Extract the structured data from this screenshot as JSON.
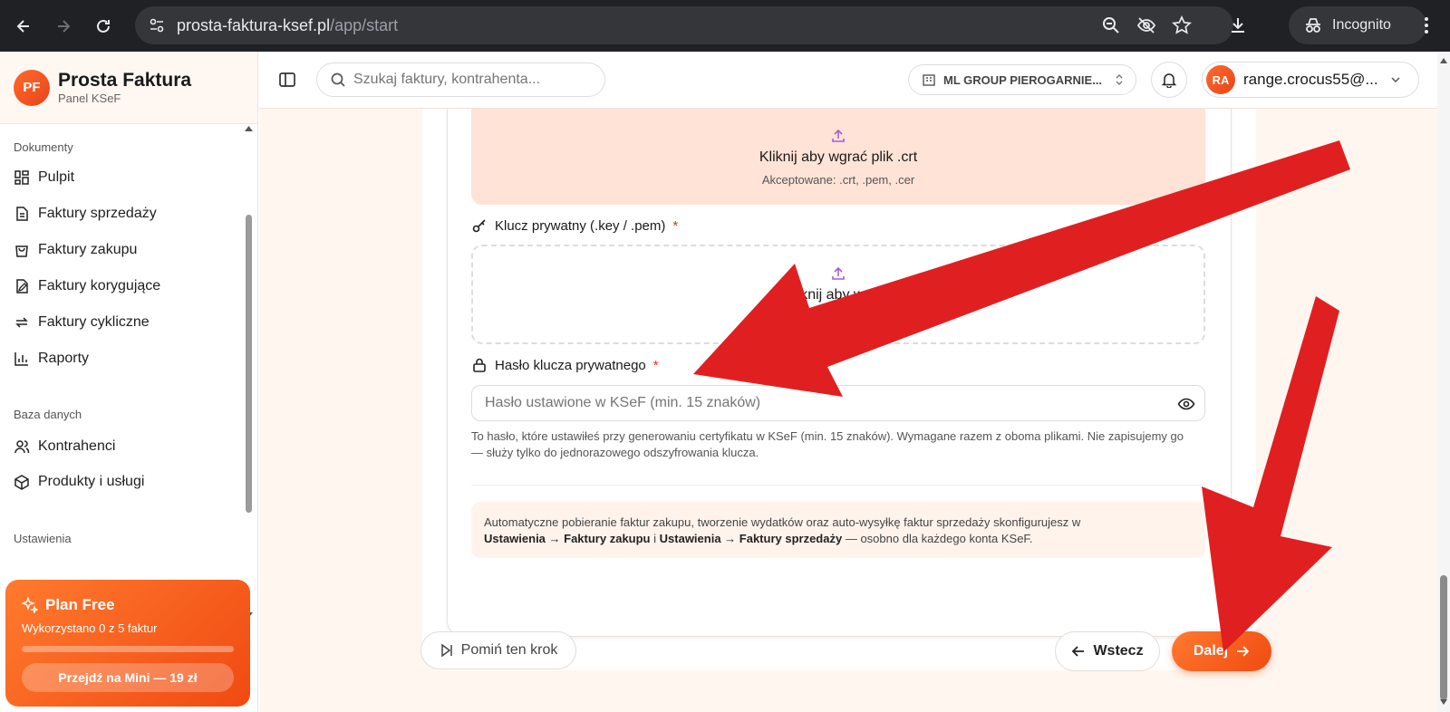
{
  "browser": {
    "url_host": "prosta-faktura-ksef.pl",
    "url_path": "/app/start",
    "incognito_label": "Incognito"
  },
  "brand": {
    "logo_text": "PF",
    "name": "Prosta Faktura",
    "subtitle": "Panel KSeF"
  },
  "sidebar": {
    "section_documents": "Dokumenty",
    "section_database": "Baza danych",
    "section_settings": "Ustawienia",
    "items": [
      {
        "label": "Pulpit",
        "icon": "dashboard-icon"
      },
      {
        "label": "Faktury sprzedaży",
        "icon": "document-icon"
      },
      {
        "label": "Faktury zakupu",
        "icon": "shopping-bag-icon"
      },
      {
        "label": "Faktury korygujące",
        "icon": "edit-document-icon"
      },
      {
        "label": "Faktury cykliczne",
        "icon": "repeat-icon"
      },
      {
        "label": "Raporty",
        "icon": "bar-chart-icon"
      },
      {
        "label": "Kontrahenci",
        "icon": "users-icon"
      },
      {
        "label": "Produkty i usługi",
        "icon": "package-icon"
      }
    ]
  },
  "plan": {
    "title": "Plan Free",
    "usage": "Wykorzystano 0 z 5 faktur",
    "usage_fraction": 0,
    "upgrade_label": "Przejdź na Mini — 19 zł"
  },
  "topbar": {
    "search_placeholder": "Szukaj faktury, kontrahenta...",
    "company": "ML GROUP PIEROGARNIE...",
    "user_initials": "RA",
    "user_email": "range.crocus55@..."
  },
  "form": {
    "cert_upload_title": "Kliknij aby wgrać plik .crt",
    "cert_upload_sub": "Akceptowane: .crt, .pem, .cer",
    "key_label": "Klucz prywatny (.key / .pem)",
    "key_upload_title": "Kliknij aby wgrać",
    "key_upload_sub": "key, .pem",
    "required_mark": "*",
    "password_label": "Hasło klucza prywatnego",
    "password_placeholder": "Hasło ustawione w KSeF (min. 15 znaków)",
    "password_hint": "To hasło, które ustawiłeś przy generowaniu certyfikatu w KSeF (min. 15 znaków). Wymagane razem z oboma plikami. Nie zapisujemy go — służy tylko do jednorazowego odszyfrowania klucza.",
    "info_prefix": "Automatyczne pobieranie faktur zakupu, tworzenie wydatków oraz auto-wysyłkę faktur sprzedaży skonfigurujesz w",
    "info_bold1": "Ustawienia → Faktury zakupu",
    "info_mid": "i",
    "info_bold2": "Ustawienia → Faktury sprzedaży",
    "info_suffix": "— osobno dla każdego konta KSeF."
  },
  "actions": {
    "skip_label": "Pomiń ten krok",
    "back_label": "Wstecz",
    "next_label": "Dalej"
  },
  "colors": {
    "accent": "#f04a12",
    "annotation_arrow": "#e02020"
  }
}
